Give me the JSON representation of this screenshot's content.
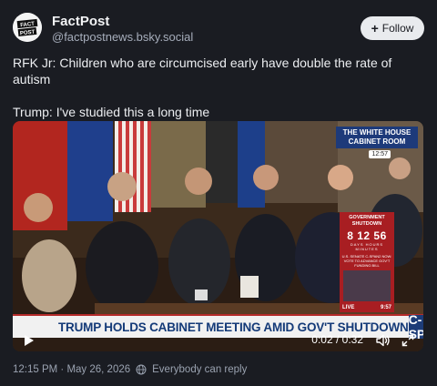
{
  "author": {
    "display_name": "FactPost",
    "handle": "@factpostnews.bsky.social",
    "avatar_text": "FACT POST"
  },
  "follow_button": {
    "label": "Follow",
    "icon": "plus-icon"
  },
  "post": {
    "paragraphs": [
      "RFK Jr: Children who are circumcised early have double the rate of autism",
      "Trump: I've studied this a long time"
    ]
  },
  "video": {
    "chyron": "TRUMP HOLDS CABINET MEETING AMID GOV'T SHUTDOWN",
    "network_logo": "C-SPAN",
    "location_label": "THE WHITE HOUSE CABINET ROOM",
    "location_time": "12:57",
    "shutdown_panel": {
      "title": "GOVERNMENT SHUTDOWN",
      "clock": "8 12 56",
      "units": "DAYS HOURS MINUTES",
      "vote_text": "U.S. SENATE C-SPAN2 NOW: VOTE TO ADVANCE GOV'T FUNDING BILL",
      "live_label": "LIVE",
      "live_time": "9:57"
    },
    "timecode": "0:02 / 0:32",
    "progress": 0.06,
    "icons": [
      "play-icon",
      "volume-icon",
      "fullscreen-icon"
    ]
  },
  "footer": {
    "timestamp": "12:15 PM · May 26, 2026",
    "reply_setting": "Everybody can reply",
    "reply_icon": "globe-icon"
  },
  "colors": {
    "background": "#1a1c22",
    "follow_bg": "#e9ebee",
    "chyron_text": "#143a78",
    "cspan_blue": "#1d3c78",
    "shutdown_red": "#a81e22"
  }
}
